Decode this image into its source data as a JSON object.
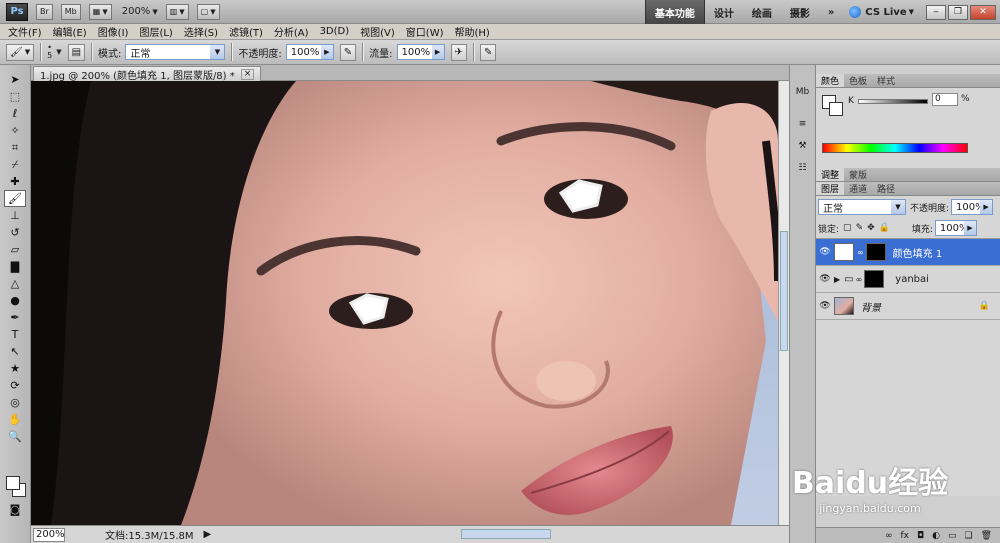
{
  "appbar": {
    "logo": "Ps",
    "btn_br": "Br",
    "btn_mb": "Mb",
    "zoom": "200%",
    "workspaces": [
      "基本功能",
      "设计",
      "绘画",
      "摄影"
    ],
    "more": "»",
    "cslive": "CS Live"
  },
  "menus": [
    "文件(F)",
    "编辑(E)",
    "图像(I)",
    "图层(L)",
    "选择(S)",
    "滤镜(T)",
    "分析(A)",
    "3D(D)",
    "视图(V)",
    "窗口(W)",
    "帮助(H)"
  ],
  "options": {
    "brush_size": "5",
    "mode_label": "模式:",
    "mode_value": "正常",
    "opacity_label": "不透明度:",
    "opacity_value": "100%",
    "flow_label": "流量:",
    "flow_value": "100%"
  },
  "document": {
    "tab_title": "1.jpg @ 200% (颜色填充 1, 图层蒙版/8) *",
    "status_zoom": "200%",
    "status_docsize": "文档:15.3M/15.8M"
  },
  "panels": {
    "color_tabs": [
      "颜色",
      "色板",
      "样式"
    ],
    "k_label": "K",
    "k_value": "0",
    "k_unit": "%",
    "adjust_tabs": [
      "调整",
      "蒙版"
    ],
    "layer_tabs": [
      "图层",
      "通道",
      "路径"
    ],
    "blend_mode": "正常",
    "opacity_label": "不透明度:",
    "opacity_value": "100%",
    "lock_label": "锁定:",
    "fill_label": "填充:",
    "fill_value": "100%",
    "layers": [
      {
        "name": "颜色填充 1",
        "selected": true
      },
      {
        "name": "yanbai",
        "selected": false
      },
      {
        "name": "背景",
        "selected": false
      }
    ],
    "footer": "fx"
  },
  "watermark": {
    "brand": "Baidu经验",
    "url": "jingyan.baidu.com"
  }
}
